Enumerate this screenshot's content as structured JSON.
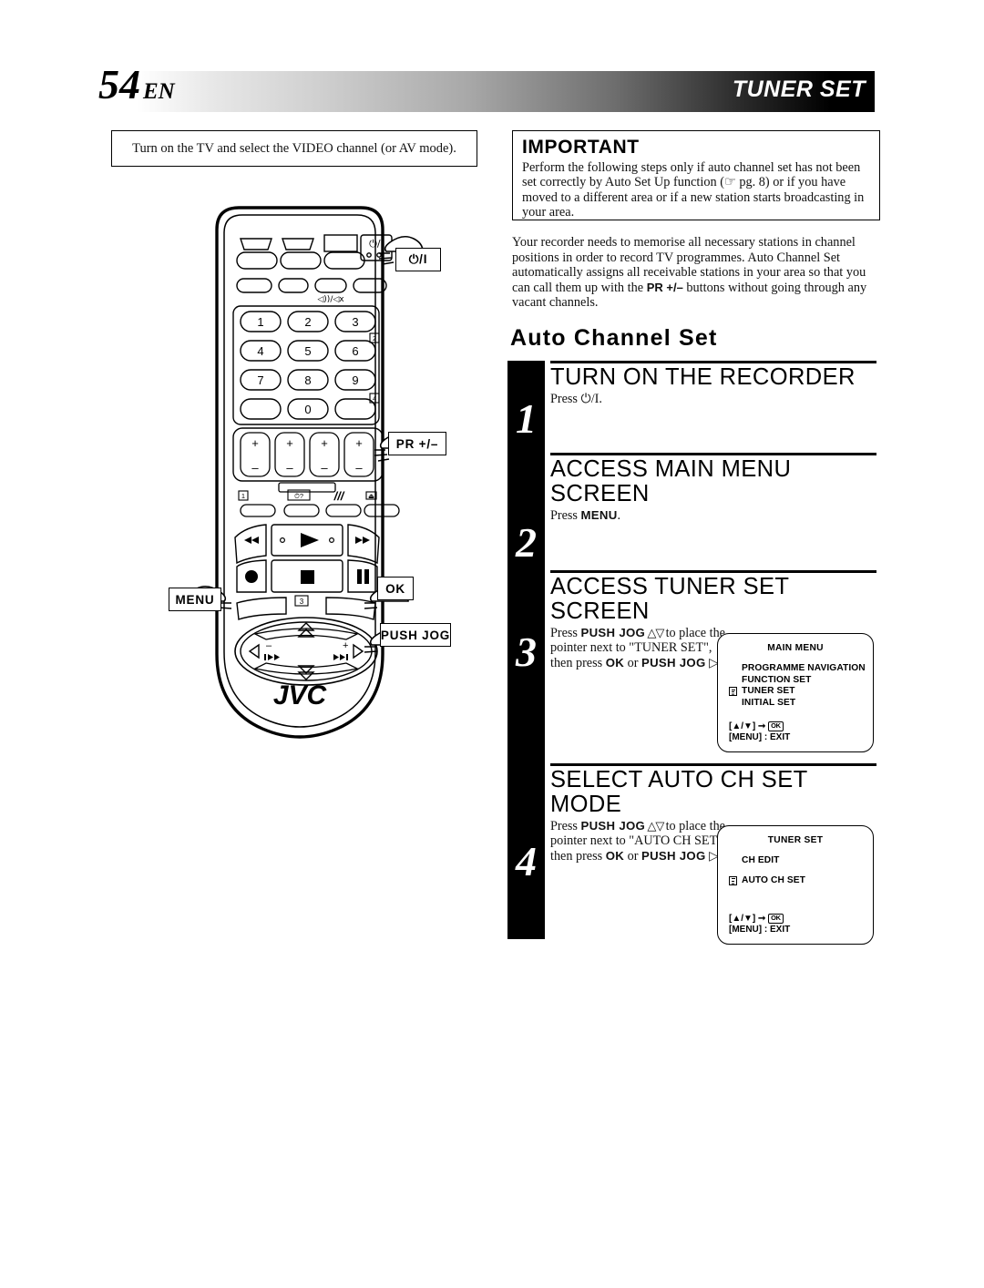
{
  "header": {
    "page_number": "54",
    "lang": "EN",
    "section": "TUNER SET"
  },
  "note_box": {
    "text": "Turn on the TV and select the VIDEO channel (or AV mode)."
  },
  "important": {
    "title": "IMPORTANT",
    "body": "Perform the following steps only if auto channel set has not been set correctly by Auto Set Up function (☞ pg. 8) or if you have moved to a different area or if a new station starts broadcasting in your area."
  },
  "intro": {
    "part1": "Your recorder needs to memorise all necessary stations in channel positions in order to record TV programmes. Auto Channel Set automatically assigns all receivable stations in your area so that you can call them up with the ",
    "bold": "PR +/–",
    "part2": " buttons without going through any vacant channels."
  },
  "section_title": "Auto Channel Set",
  "steps": [
    {
      "number": "1",
      "heading": "TURN ON THE RECORDER",
      "body_pre": "Press ",
      "body_bold": "",
      "body_post": "⏻/I."
    },
    {
      "number": "2",
      "heading": "ACCESS MAIN MENU SCREEN",
      "body_pre": "Press ",
      "body_bold": "MENU",
      "body_post": "."
    },
    {
      "number": "3",
      "heading": "ACCESS TUNER SET SCREEN",
      "line1_pre": "Press ",
      "line1_bold": "PUSH JOG",
      "line1_arrows": " △▽ ",
      "line1_post": "to place the pointer next to \"TUNER SET\", then press ",
      "line2_bold1": "OK",
      "line2_mid": " or ",
      "line2_bold2": "PUSH JOG",
      "line2_post": " ▷."
    },
    {
      "number": "4",
      "heading": "SELECT AUTO CH SET MODE",
      "line1_pre": "Press ",
      "line1_bold": "PUSH JOG",
      "line1_arrows": " △▽ ",
      "line1_post": "to place the pointer next to \"AUTO CH SET\", then press ",
      "line2_bold1": "OK",
      "line2_mid": " or ",
      "line2_bold2": "PUSH JOG",
      "line2_post": " ▷."
    }
  ],
  "osd_main_menu": {
    "title": "MAIN MENU",
    "items": [
      {
        "label": "PROGRAMME NAVIGATION",
        "selected": false
      },
      {
        "label": "FUNCTION SET",
        "selected": false
      },
      {
        "label": "TUNER SET",
        "selected": true
      },
      {
        "label": "INITIAL SET",
        "selected": false
      }
    ],
    "foot_line1_pre": "[▲/▼] ➞ ",
    "foot_ok": "OK",
    "foot_line2": "[MENU] : EXIT"
  },
  "osd_tuner_set": {
    "title": "TUNER SET",
    "items": [
      {
        "label": "CH EDIT",
        "selected": false
      },
      {
        "label": "AUTO CH SET",
        "selected": true
      }
    ],
    "foot_line1_pre": "[▲/▼] ➞ ",
    "foot_ok": "OK",
    "foot_line2": "[MENU] : EXIT"
  },
  "remote": {
    "brand": "JVC",
    "callouts": {
      "power": "⏻/I",
      "pr": "PR +/–",
      "menu": "MENU",
      "ok": "OK",
      "push_jog": "PUSH JOG"
    },
    "keypad": [
      "1",
      "2",
      "3",
      "4",
      "5",
      "6",
      "7",
      "8",
      "9",
      "0"
    ],
    "power_label": "⏻/I"
  }
}
